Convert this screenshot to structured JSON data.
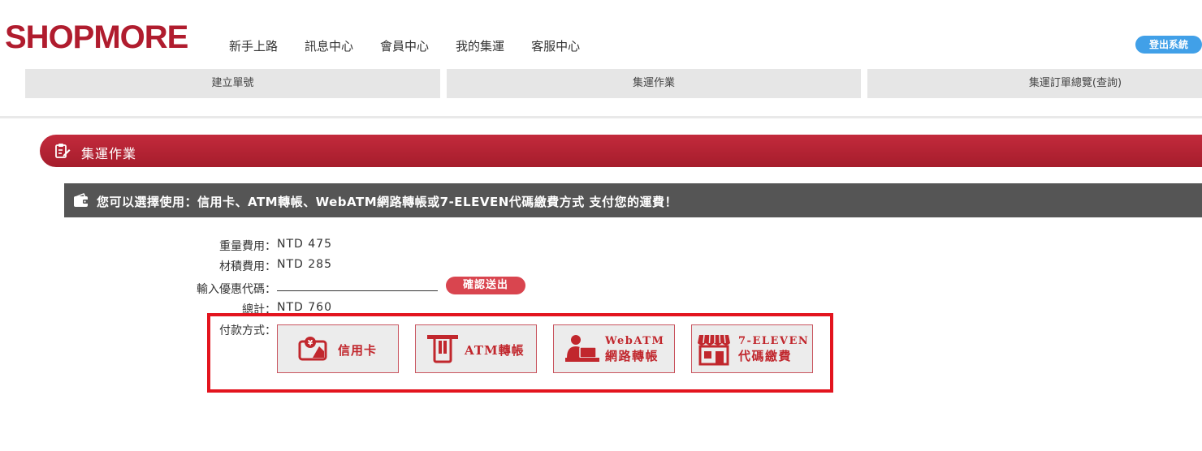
{
  "brand": {
    "logo": "SHOPMORE",
    "accent": "#b01c2e"
  },
  "topnav": [
    "新手上路",
    "訊息中心",
    "會員中心",
    "我的集運",
    "客服中心"
  ],
  "logout_label": "登出系統",
  "subnav": [
    "建立單號",
    "集運作業",
    "集運訂單總覽(查詢)"
  ],
  "section": {
    "title": "集運作業",
    "icon": "clipboard-edit-icon"
  },
  "info": {
    "text": "您可以選擇使用：信用卡、ATM轉帳、WebATM網路轉帳或7-ELEVEN代碼繳費方式 支付您的運費！",
    "icon": "wallet-icon"
  },
  "fees": {
    "weight_label": "重量費用：",
    "weight_value": "NTD 475",
    "volume_label": "材積費用：",
    "volume_value": "NTD 285",
    "coupon_label": "輸入優惠代碼：",
    "coupon_value": "",
    "confirm_label": "確認送出",
    "total_label": "總計：",
    "total_value": "NTD 760"
  },
  "payment": {
    "label": "付款方式：",
    "options": [
      {
        "icon": "credit-card-icon",
        "line1": "信用卡",
        "line2": ""
      },
      {
        "icon": "atm-card-icon",
        "line1": "ATM轉帳",
        "line2": ""
      },
      {
        "icon": "webatm-computer-user-icon",
        "line1": "WebATM",
        "line2": "網路轉帳"
      },
      {
        "icon": "convenience-store-icon",
        "line1": "7-ELEVEN",
        "line2": "代碼繳費"
      }
    ]
  },
  "colors": {
    "section_bar": "#b52536",
    "info_bar": "#555555",
    "highlight_border": "#e3141e",
    "logout": "#41a0e8",
    "confirm": "#d9454f"
  }
}
